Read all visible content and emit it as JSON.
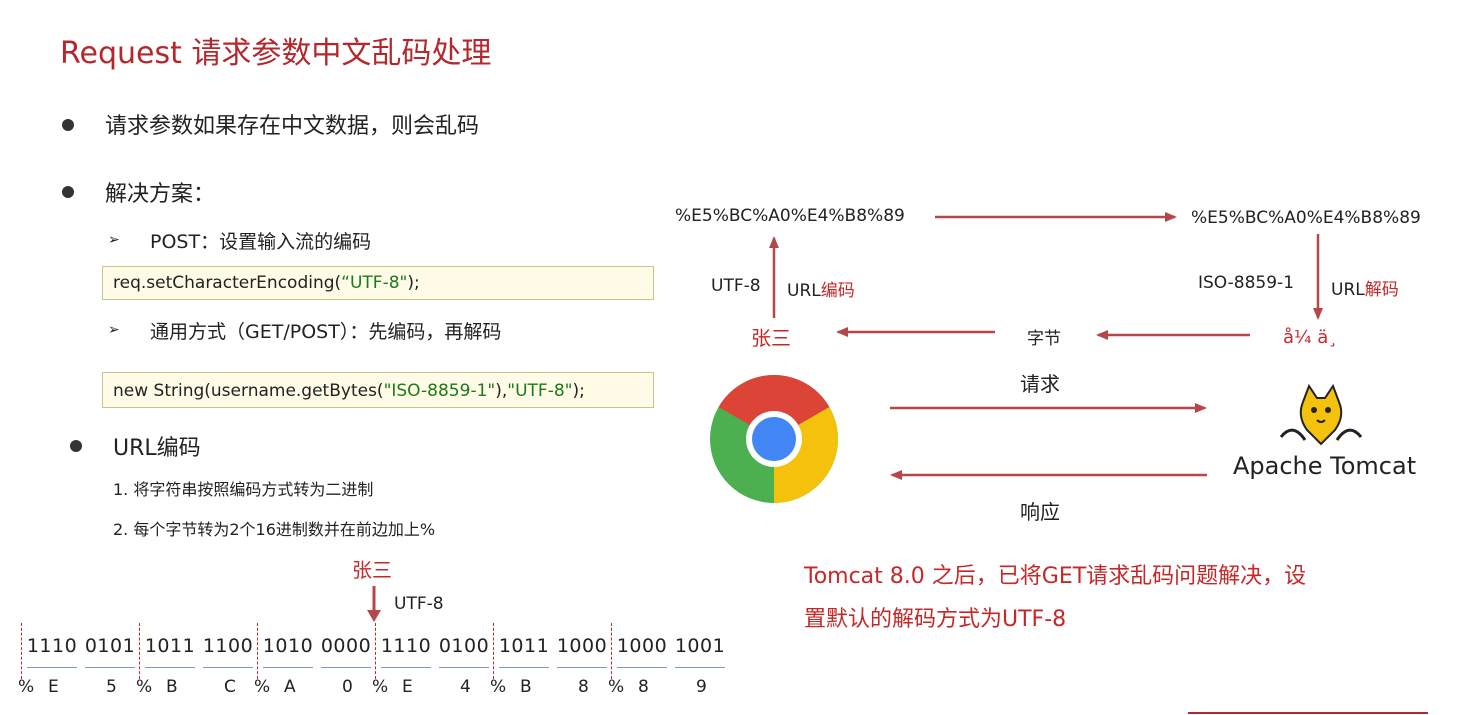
{
  "title": "Request 请求参数中文乱码处理",
  "left": {
    "bullet1": "请求参数如果存在中文数据，则会乱码",
    "bullet2": "解决方案：",
    "post_label": "POST：设置输入流的编码",
    "post_code_prefix": "req.setCharacterEncoding(",
    "post_code_str": "“UTF-8\"",
    "post_code_suffix": ");",
    "general_label": "通用方式（GET/POST）：先编码，再解码",
    "general_code_prefix": "new String(username.getBytes(",
    "general_code_str1": "\"ISO-8859-1\"",
    "general_code_mid": "),",
    "general_code_str2": "\"UTF-8\"",
    "general_code_suffix": ");",
    "bullet3": "URL编码",
    "step1": "1. 将字符串按照编码方式转为二进制",
    "step2": "2. 每个字节转为2个16进制数并在前边加上%",
    "sample": "张三",
    "sample_encoding": "UTF-8",
    "bits": [
      "1110",
      "0101",
      "1011",
      "1100",
      "1010",
      "0000",
      "1110",
      "0100",
      "1011",
      "1000",
      "1000",
      "1001"
    ],
    "hex_row": [
      "%",
      "E",
      "5",
      "%",
      "B",
      "C",
      "%",
      "A",
      "0",
      "%",
      "E",
      "4",
      "%",
      "B",
      "8",
      "%",
      "8",
      "9"
    ]
  },
  "right": {
    "encoded_left": "%E5%BC%A0%E4%B8%89",
    "encoded_right": "%E5%BC%A0%E4%B8%89",
    "utf8_label": "UTF-8",
    "url_encode_prefix": "URL",
    "url_encode_suffix": "编码",
    "iso_label": "ISO-8859-1",
    "url_decode_prefix": "URL",
    "url_decode_suffix": "解码",
    "name": "张三",
    "bytes_label": "字节",
    "garbled": "å¼ ä¸",
    "request_label": "请求",
    "response_label": "响应",
    "server_name": "Apache Tomcat",
    "note_line1": "Tomcat 8.0 之后，已将GET请求乱码问题解决，设",
    "note_line2": "置默认的解码方式为UTF-8"
  },
  "colors": {
    "accent": "#b4282d",
    "arrow": "#b5474b",
    "code_string": "#1a7a1a"
  }
}
